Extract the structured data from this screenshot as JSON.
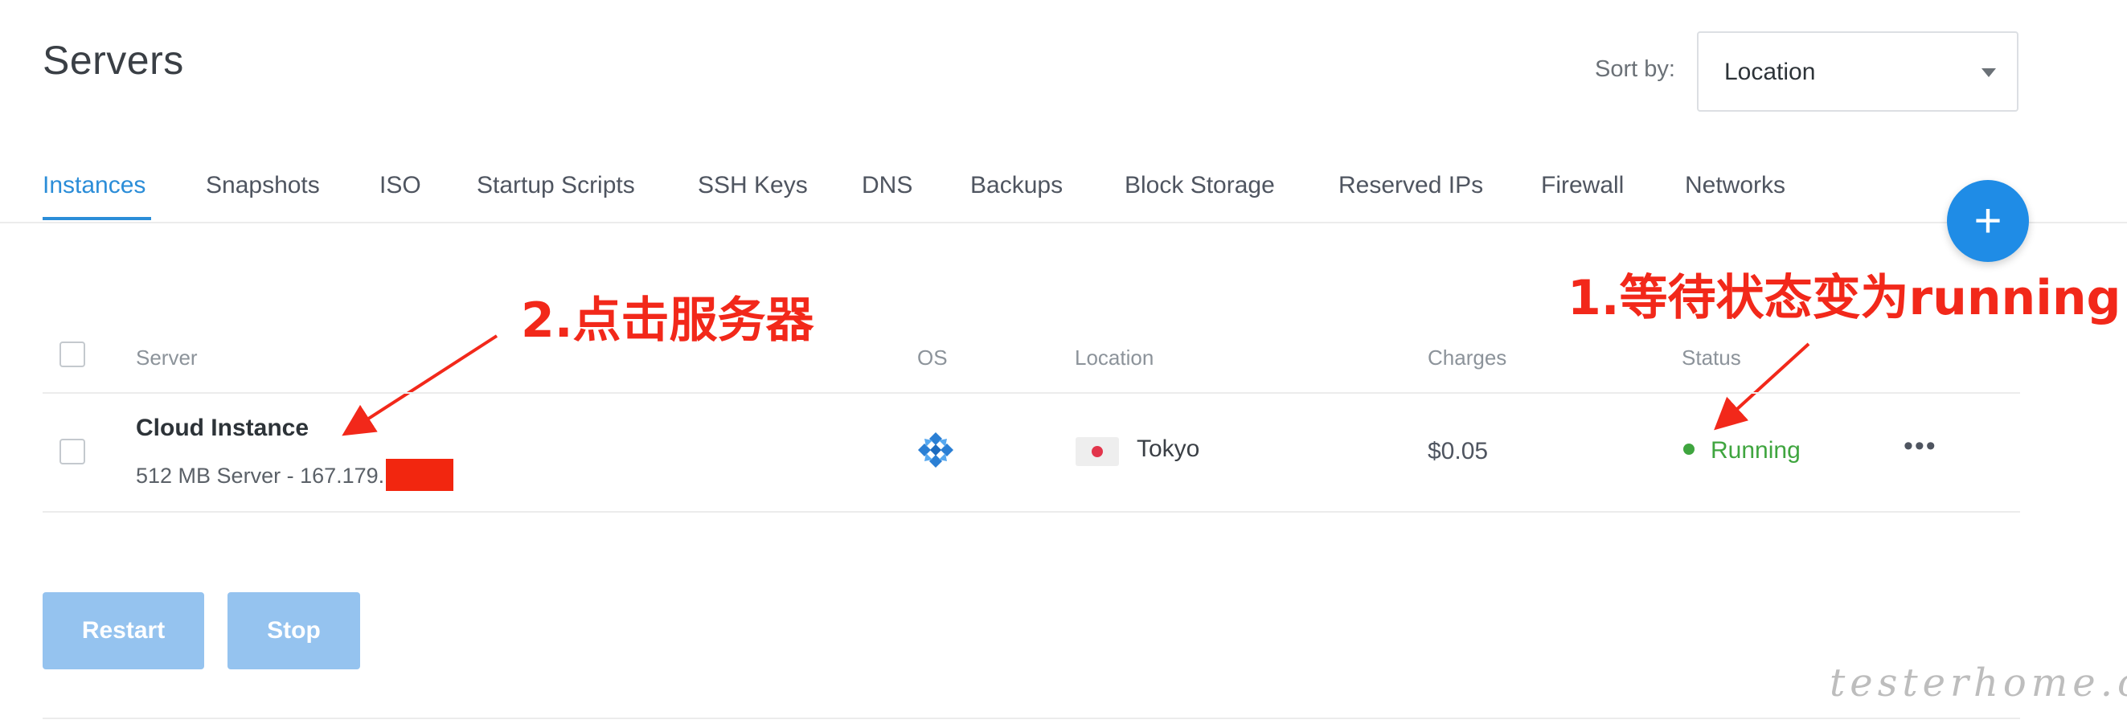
{
  "header": {
    "title": "Servers",
    "sort_label": "Sort by:",
    "sort_value": "Location"
  },
  "tabs": [
    {
      "label": "Instances",
      "active": true
    },
    {
      "label": "Snapshots",
      "active": false
    },
    {
      "label": "ISO",
      "active": false
    },
    {
      "label": "Startup Scripts",
      "active": false
    },
    {
      "label": "SSH Keys",
      "active": false
    },
    {
      "label": "DNS",
      "active": false
    },
    {
      "label": "Backups",
      "active": false
    },
    {
      "label": "Block Storage",
      "active": false
    },
    {
      "label": "Reserved IPs",
      "active": false
    },
    {
      "label": "Firewall",
      "active": false
    },
    {
      "label": "Networks",
      "active": false
    }
  ],
  "add_button": {
    "label": "+",
    "icon": "plus-icon"
  },
  "table": {
    "columns": [
      "Server",
      "OS",
      "Location",
      "Charges",
      "Status"
    ],
    "rows": [
      {
        "name": "Cloud Instance",
        "subtitle": "512 MB Server - 167.179.",
        "os_icon": "os-logo-icon",
        "location_flag": "flag-japan-icon",
        "location": "Tokyo",
        "charges": "$0.05",
        "status": "Running",
        "status_color": "#3fa53f",
        "more": "•••"
      }
    ]
  },
  "actions": {
    "restart": "Restart",
    "stop": "Stop"
  },
  "annotations": {
    "click_server": "2.点击服务器",
    "wait_running": "1.等待状态变为running",
    "color": "#f2281a"
  },
  "watermark": "testerhome.com",
  "colors": {
    "accent": "#2b8dd8",
    "fab": "#1f8ce6",
    "disabled_button": "#95c3ef"
  }
}
